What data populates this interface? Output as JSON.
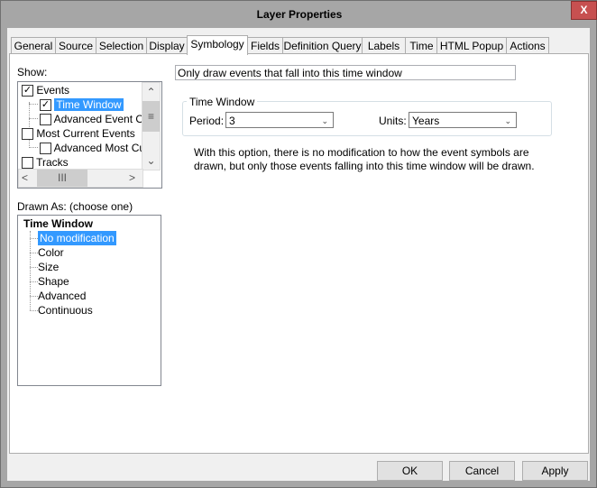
{
  "window": {
    "title": "Layer Properties",
    "close_label": "X"
  },
  "tabs": [
    {
      "label": "General"
    },
    {
      "label": "Source"
    },
    {
      "label": "Selection"
    },
    {
      "label": "Display"
    },
    {
      "label": "Symbology",
      "active": true
    },
    {
      "label": "Fields"
    },
    {
      "label": "Definition Query"
    },
    {
      "label": "Labels"
    },
    {
      "label": "Time"
    },
    {
      "label": "HTML Popup"
    },
    {
      "label": "Actions"
    }
  ],
  "show": {
    "label": "Show:",
    "items": [
      {
        "label": "Events",
        "checked": true
      },
      {
        "label": "Time Window",
        "checked": true,
        "selected": true
      },
      {
        "label": "Advanced Event Op",
        "checked": false
      },
      {
        "label": "Most Current Events",
        "checked": false
      },
      {
        "label": "Advanced Most Curr",
        "checked": false
      },
      {
        "label": "Tracks",
        "checked": false
      }
    ]
  },
  "drawn_as": {
    "label": "Drawn As: (choose one)",
    "root": "Time Window",
    "items": [
      "No modification",
      "Color",
      "Size",
      "Shape",
      "Advanced",
      "Continuous"
    ],
    "selected": "No modification"
  },
  "description": "Only draw events that fall into this time window",
  "time_window": {
    "legend": "Time Window",
    "period_label": "Period:",
    "period_value": "3",
    "units_label": "Units:",
    "units_value": "Years"
  },
  "note": "With this option, there is no modification to how the event symbols are drawn, but only those events falling into this time window will be drawn.",
  "buttons": {
    "ok": "OK",
    "cancel": "Cancel",
    "apply": "Apply"
  }
}
